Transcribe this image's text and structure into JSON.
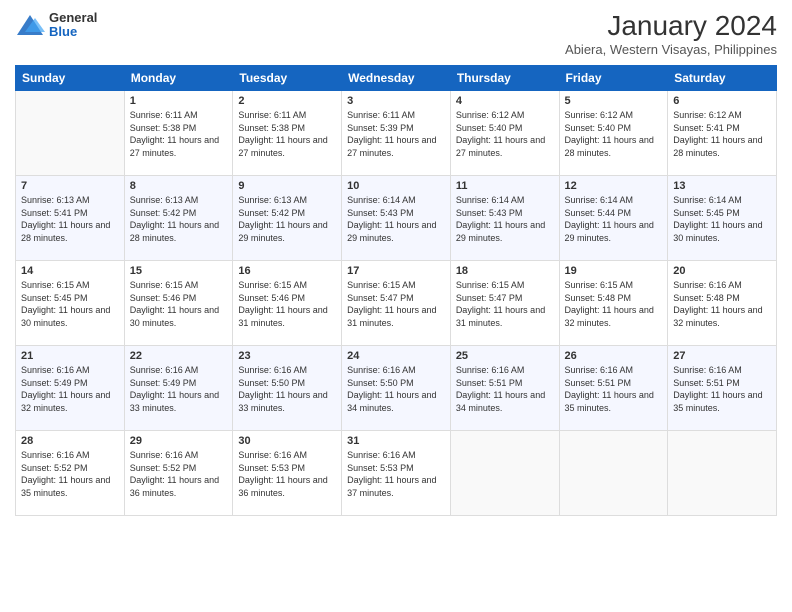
{
  "logo": {
    "general": "General",
    "blue": "Blue"
  },
  "title": "January 2024",
  "location": "Abiera, Western Visayas, Philippines",
  "days": [
    "Sunday",
    "Monday",
    "Tuesday",
    "Wednesday",
    "Thursday",
    "Friday",
    "Saturday"
  ],
  "weeks": [
    [
      {
        "day": "",
        "sunrise": "",
        "sunset": "",
        "daylight": ""
      },
      {
        "day": "1",
        "sunrise": "Sunrise: 6:11 AM",
        "sunset": "Sunset: 5:38 PM",
        "daylight": "Daylight: 11 hours and 27 minutes."
      },
      {
        "day": "2",
        "sunrise": "Sunrise: 6:11 AM",
        "sunset": "Sunset: 5:38 PM",
        "daylight": "Daylight: 11 hours and 27 minutes."
      },
      {
        "day": "3",
        "sunrise": "Sunrise: 6:11 AM",
        "sunset": "Sunset: 5:39 PM",
        "daylight": "Daylight: 11 hours and 27 minutes."
      },
      {
        "day": "4",
        "sunrise": "Sunrise: 6:12 AM",
        "sunset": "Sunset: 5:40 PM",
        "daylight": "Daylight: 11 hours and 27 minutes."
      },
      {
        "day": "5",
        "sunrise": "Sunrise: 6:12 AM",
        "sunset": "Sunset: 5:40 PM",
        "daylight": "Daylight: 11 hours and 28 minutes."
      },
      {
        "day": "6",
        "sunrise": "Sunrise: 6:12 AM",
        "sunset": "Sunset: 5:41 PM",
        "daylight": "Daylight: 11 hours and 28 minutes."
      }
    ],
    [
      {
        "day": "7",
        "sunrise": "Sunrise: 6:13 AM",
        "sunset": "Sunset: 5:41 PM",
        "daylight": "Daylight: 11 hours and 28 minutes."
      },
      {
        "day": "8",
        "sunrise": "Sunrise: 6:13 AM",
        "sunset": "Sunset: 5:42 PM",
        "daylight": "Daylight: 11 hours and 28 minutes."
      },
      {
        "day": "9",
        "sunrise": "Sunrise: 6:13 AM",
        "sunset": "Sunset: 5:42 PM",
        "daylight": "Daylight: 11 hours and 29 minutes."
      },
      {
        "day": "10",
        "sunrise": "Sunrise: 6:14 AM",
        "sunset": "Sunset: 5:43 PM",
        "daylight": "Daylight: 11 hours and 29 minutes."
      },
      {
        "day": "11",
        "sunrise": "Sunrise: 6:14 AM",
        "sunset": "Sunset: 5:43 PM",
        "daylight": "Daylight: 11 hours and 29 minutes."
      },
      {
        "day": "12",
        "sunrise": "Sunrise: 6:14 AM",
        "sunset": "Sunset: 5:44 PM",
        "daylight": "Daylight: 11 hours and 29 minutes."
      },
      {
        "day": "13",
        "sunrise": "Sunrise: 6:14 AM",
        "sunset": "Sunset: 5:45 PM",
        "daylight": "Daylight: 11 hours and 30 minutes."
      }
    ],
    [
      {
        "day": "14",
        "sunrise": "Sunrise: 6:15 AM",
        "sunset": "Sunset: 5:45 PM",
        "daylight": "Daylight: 11 hours and 30 minutes."
      },
      {
        "day": "15",
        "sunrise": "Sunrise: 6:15 AM",
        "sunset": "Sunset: 5:46 PM",
        "daylight": "Daylight: 11 hours and 30 minutes."
      },
      {
        "day": "16",
        "sunrise": "Sunrise: 6:15 AM",
        "sunset": "Sunset: 5:46 PM",
        "daylight": "Daylight: 11 hours and 31 minutes."
      },
      {
        "day": "17",
        "sunrise": "Sunrise: 6:15 AM",
        "sunset": "Sunset: 5:47 PM",
        "daylight": "Daylight: 11 hours and 31 minutes."
      },
      {
        "day": "18",
        "sunrise": "Sunrise: 6:15 AM",
        "sunset": "Sunset: 5:47 PM",
        "daylight": "Daylight: 11 hours and 31 minutes."
      },
      {
        "day": "19",
        "sunrise": "Sunrise: 6:15 AM",
        "sunset": "Sunset: 5:48 PM",
        "daylight": "Daylight: 11 hours and 32 minutes."
      },
      {
        "day": "20",
        "sunrise": "Sunrise: 6:16 AM",
        "sunset": "Sunset: 5:48 PM",
        "daylight": "Daylight: 11 hours and 32 minutes."
      }
    ],
    [
      {
        "day": "21",
        "sunrise": "Sunrise: 6:16 AM",
        "sunset": "Sunset: 5:49 PM",
        "daylight": "Daylight: 11 hours and 32 minutes."
      },
      {
        "day": "22",
        "sunrise": "Sunrise: 6:16 AM",
        "sunset": "Sunset: 5:49 PM",
        "daylight": "Daylight: 11 hours and 33 minutes."
      },
      {
        "day": "23",
        "sunrise": "Sunrise: 6:16 AM",
        "sunset": "Sunset: 5:50 PM",
        "daylight": "Daylight: 11 hours and 33 minutes."
      },
      {
        "day": "24",
        "sunrise": "Sunrise: 6:16 AM",
        "sunset": "Sunset: 5:50 PM",
        "daylight": "Daylight: 11 hours and 34 minutes."
      },
      {
        "day": "25",
        "sunrise": "Sunrise: 6:16 AM",
        "sunset": "Sunset: 5:51 PM",
        "daylight": "Daylight: 11 hours and 34 minutes."
      },
      {
        "day": "26",
        "sunrise": "Sunrise: 6:16 AM",
        "sunset": "Sunset: 5:51 PM",
        "daylight": "Daylight: 11 hours and 35 minutes."
      },
      {
        "day": "27",
        "sunrise": "Sunrise: 6:16 AM",
        "sunset": "Sunset: 5:51 PM",
        "daylight": "Daylight: 11 hours and 35 minutes."
      }
    ],
    [
      {
        "day": "28",
        "sunrise": "Sunrise: 6:16 AM",
        "sunset": "Sunset: 5:52 PM",
        "daylight": "Daylight: 11 hours and 35 minutes."
      },
      {
        "day": "29",
        "sunrise": "Sunrise: 6:16 AM",
        "sunset": "Sunset: 5:52 PM",
        "daylight": "Daylight: 11 hours and 36 minutes."
      },
      {
        "day": "30",
        "sunrise": "Sunrise: 6:16 AM",
        "sunset": "Sunset: 5:53 PM",
        "daylight": "Daylight: 11 hours and 36 minutes."
      },
      {
        "day": "31",
        "sunrise": "Sunrise: 6:16 AM",
        "sunset": "Sunset: 5:53 PM",
        "daylight": "Daylight: 11 hours and 37 minutes."
      },
      {
        "day": "",
        "sunrise": "",
        "sunset": "",
        "daylight": ""
      },
      {
        "day": "",
        "sunrise": "",
        "sunset": "",
        "daylight": ""
      },
      {
        "day": "",
        "sunrise": "",
        "sunset": "",
        "daylight": ""
      }
    ]
  ]
}
